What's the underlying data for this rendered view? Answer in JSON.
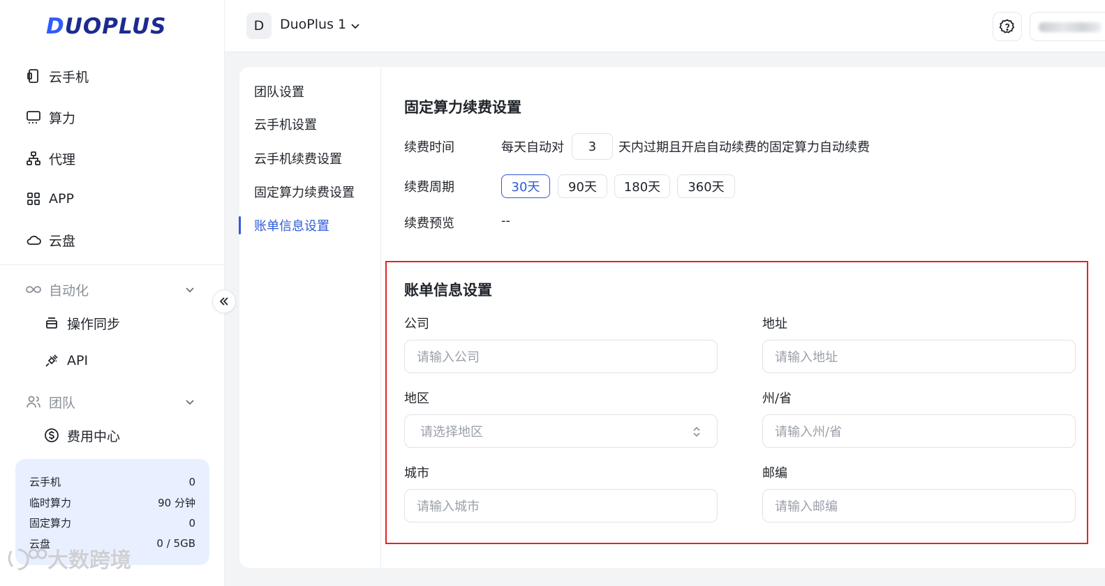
{
  "brand": {
    "logo_text": "DUOPLUS"
  },
  "sidebar": {
    "items": [
      {
        "label": "云手机",
        "icon": "phone-icon"
      },
      {
        "label": "算力",
        "icon": "monitor-icon"
      },
      {
        "label": "代理",
        "icon": "network-icon"
      },
      {
        "label": "APP",
        "icon": "grid-icon"
      },
      {
        "label": "云盘",
        "icon": "cloud-icon"
      }
    ],
    "groups": [
      {
        "label": "自动化",
        "icon": "infinity-icon",
        "children": [
          {
            "label": "操作同步",
            "icon": "layers-icon"
          },
          {
            "label": "API",
            "icon": "plug-icon"
          }
        ]
      },
      {
        "label": "团队",
        "icon": "users-icon",
        "children": [
          {
            "label": "费用中心",
            "icon": "dollar-circle-icon"
          }
        ]
      }
    ],
    "stats": [
      {
        "label": "云手机",
        "value": "0"
      },
      {
        "label": "临时算力",
        "value": "90 分钟"
      },
      {
        "label": "固定算力",
        "value": "0"
      },
      {
        "label": "云盘",
        "value": "0 / 5GB"
      }
    ],
    "watermark": "大数跨境"
  },
  "header": {
    "team_initial": "D",
    "team_name": "DuoPlus 1"
  },
  "settings_nav": {
    "items": [
      "团队设置",
      "云手机设置",
      "云手机续费设置",
      "固定算力续费设置",
      "账单信息设置"
    ],
    "active_index": 4
  },
  "renewal": {
    "title": "固定算力续费设置",
    "time_label": "续费时间",
    "time_prefix": "每天自动对",
    "time_days": "3",
    "time_suffix": "天内过期且开启自动续费的固定算力自动续费",
    "period_label": "续费周期",
    "periods": [
      "30天",
      "90天",
      "180天",
      "360天"
    ],
    "selected_period": "30天",
    "preview_label": "续费预览",
    "preview_value": "--"
  },
  "billing": {
    "title": "账单信息设置",
    "company_label": "公司",
    "company_placeholder": "请输入公司",
    "address_label": "地址",
    "address_placeholder": "请输入地址",
    "region_label": "地区",
    "region_placeholder": "请选择地区",
    "state_label": "州/省",
    "state_placeholder": "请输入州/省",
    "city_label": "城市",
    "city_placeholder": "请输入城市",
    "zip_label": "邮编",
    "zip_placeholder": "请输入邮编"
  },
  "colors": {
    "accent": "#2f5bd6",
    "highlight_border": "#e02424",
    "stats_bg": "#e8efff"
  }
}
